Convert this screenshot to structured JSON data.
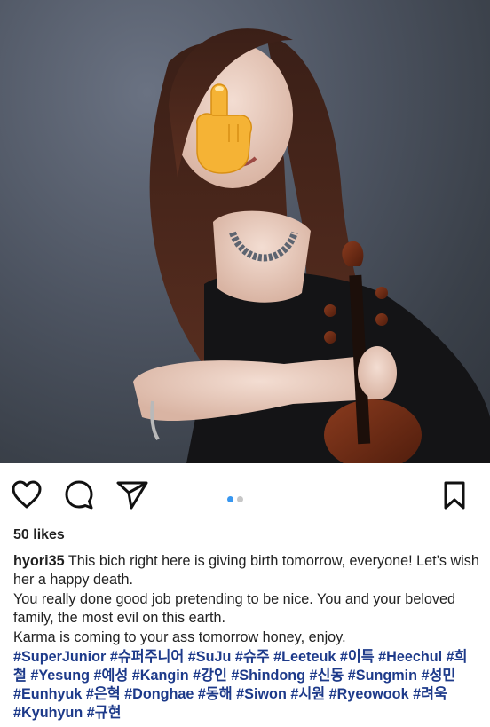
{
  "post": {
    "image_alt": "Woman in black dress holding a violin, face partly covered by a middle finger emoji",
    "likes": "50 likes",
    "username": "hyori35",
    "caption_line1": "This bich right here is giving birth tomorrow, everyone! Let’s wish her a happy death.",
    "caption_line2": "You really done good job pretending to be nice. You and your beloved family, the most evil on this earth.",
    "caption_line3": "Karma is coming to your ass tomorrow honey, enjoy.",
    "hashtags": "#SuperJunior #슈퍼주니어 #SuJu #슈주 #Leeteuk #이특 #Heechul #희철 #Yesung #예성 #Kangin #강인 #Shindong #신동 #Sungmin #성민 #Eunhyuk #은혁 #Donghae #동해 #Siwon #시원 #Ryeowook #려욱 #Kyuhyun #규현"
  },
  "actions": {
    "like_icon": "heart-icon",
    "comment_icon": "comment-icon",
    "share_icon": "paper-plane-icon",
    "save_icon": "bookmark-icon"
  },
  "carousel": {
    "count": 2,
    "active_index": 0,
    "active_color": "#3897f0",
    "inactive_color": "#c7c7c7"
  },
  "colors": {
    "hashtag": "#1d3a8a",
    "emoji": "#f5b335"
  }
}
